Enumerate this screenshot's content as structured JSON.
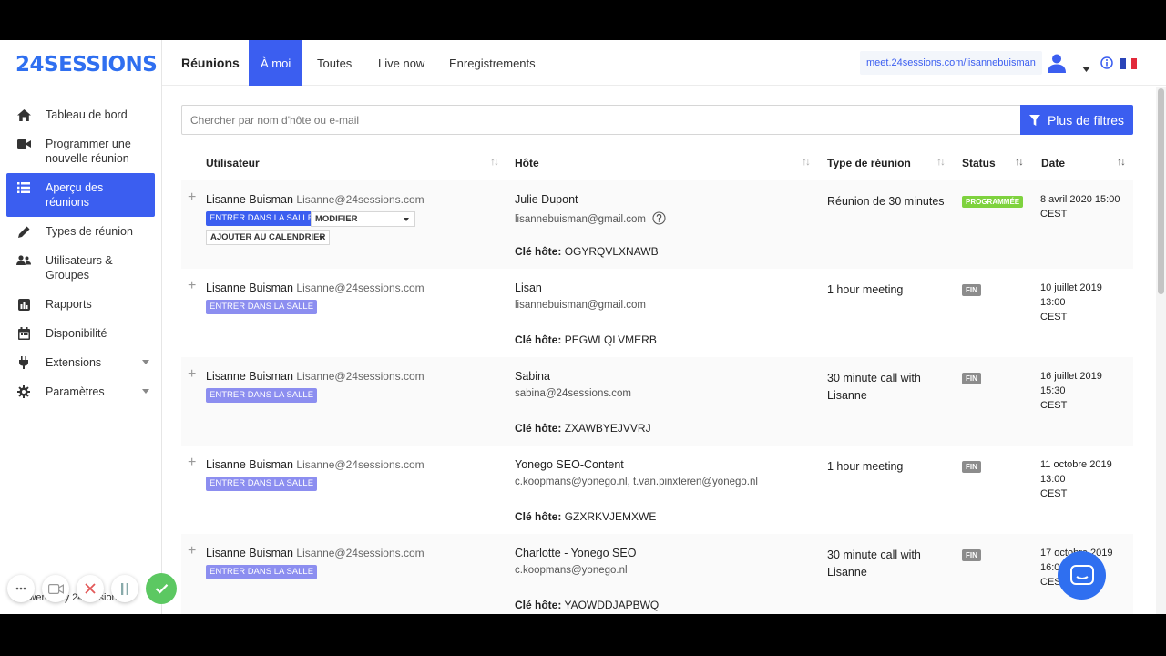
{
  "app": {
    "logo_text": "24SESSIONS",
    "brand_color": "#2f6ff0",
    "accent_color": "#3b5ef0"
  },
  "sidebar": {
    "items": [
      {
        "label": "Tableau de bord",
        "icon": "home-icon"
      },
      {
        "label": "Programmer une nouvelle réunion",
        "icon": "video-camera-icon"
      },
      {
        "label": "Aperçu des réunions",
        "icon": "list-icon",
        "active": true
      },
      {
        "label": "Types de réunion",
        "icon": "pencil-icon"
      },
      {
        "label": "Utilisateurs & Groupes",
        "icon": "users-icon"
      },
      {
        "label": "Rapports",
        "icon": "bar-chart-icon"
      },
      {
        "label": "Disponibilité",
        "icon": "calendar-icon"
      },
      {
        "label": "Extensions",
        "icon": "plug-icon",
        "has_caret": true
      },
      {
        "label": "Paramètres",
        "icon": "gear-icon",
        "has_caret": true
      }
    ]
  },
  "header": {
    "title": "Réunions",
    "tabs": [
      {
        "label": "À moi",
        "active": true
      },
      {
        "label": "Toutes"
      },
      {
        "label": "Live now"
      },
      {
        "label": "Enregistrements"
      }
    ],
    "meet_link": "meet.24sessions.com/lisannebuisman"
  },
  "search": {
    "placeholder": "Chercher par nom d'hôte ou e-mail",
    "filter_label": "Plus de filtres"
  },
  "table": {
    "columns": [
      "Utilisateur",
      "Hôte",
      "Type de réunion",
      "Status",
      "Date"
    ],
    "key_label": "Clé hôte:",
    "enter_label": "ENTRER DANS LA SALLE",
    "modify_label": "MODIFIER",
    "calendar_label": "AJOUTER AU CALENDRIER",
    "rows": [
      {
        "user_name": "Lisanne Buisman",
        "user_email": "Lisanne@24sessions.com",
        "host": "Julie Dupont",
        "host_email": "lisannebuisman@gmail.com",
        "host_key": "OGYRQVLXNAWB",
        "meeting_type": "Réunion de 30 minutes",
        "status": "PROGRAMMÉE",
        "date": [
          "8 avril 2020 15:00",
          "CEST"
        ]
      },
      {
        "user_name": "Lisanne Buisman",
        "user_email": "Lisanne@24sessions.com",
        "host": "Lisan",
        "host_email": "lisannebuisman@gmail.com",
        "host_key": "PEGWLQLVMERB",
        "meeting_type": "1 hour meeting",
        "status": "FIN",
        "date": [
          "10 juillet 2019",
          "13:00",
          "CEST"
        ]
      },
      {
        "user_name": "Lisanne Buisman",
        "user_email": "Lisanne@24sessions.com",
        "host": "Sabina",
        "host_email": "sabina@24sessions.com",
        "host_key": "ZXAWBYEJVVRJ",
        "meeting_type": "30 minute call with Lisanne",
        "status": "FIN",
        "date": [
          "16 juillet 2019",
          "15:30",
          "CEST"
        ]
      },
      {
        "user_name": "Lisanne Buisman",
        "user_email": "Lisanne@24sessions.com",
        "host": "Yonego SEO-Content",
        "host_email": "c.koopmans@yonego.nl, t.van.pinxteren@yonego.nl",
        "host_key": "GZXRKVJEMXWE",
        "meeting_type": "1 hour meeting",
        "status": "FIN",
        "date": [
          "11 octobre 2019",
          "13:00",
          "CEST"
        ]
      },
      {
        "user_name": "Lisanne Buisman",
        "user_email": "Lisanne@24sessions.com",
        "host": "Charlotte - Yonego SEO",
        "host_email": "c.koopmans@yonego.nl",
        "host_key": "YAOWDDJAPBWQ",
        "meeting_type": "30 minute call with Lisanne",
        "status": "FIN",
        "date": [
          "17 octobre 2019",
          "16:00",
          "CEST"
        ]
      }
    ]
  },
  "footer": {
    "powered_by": "Powered by 24sessions"
  }
}
